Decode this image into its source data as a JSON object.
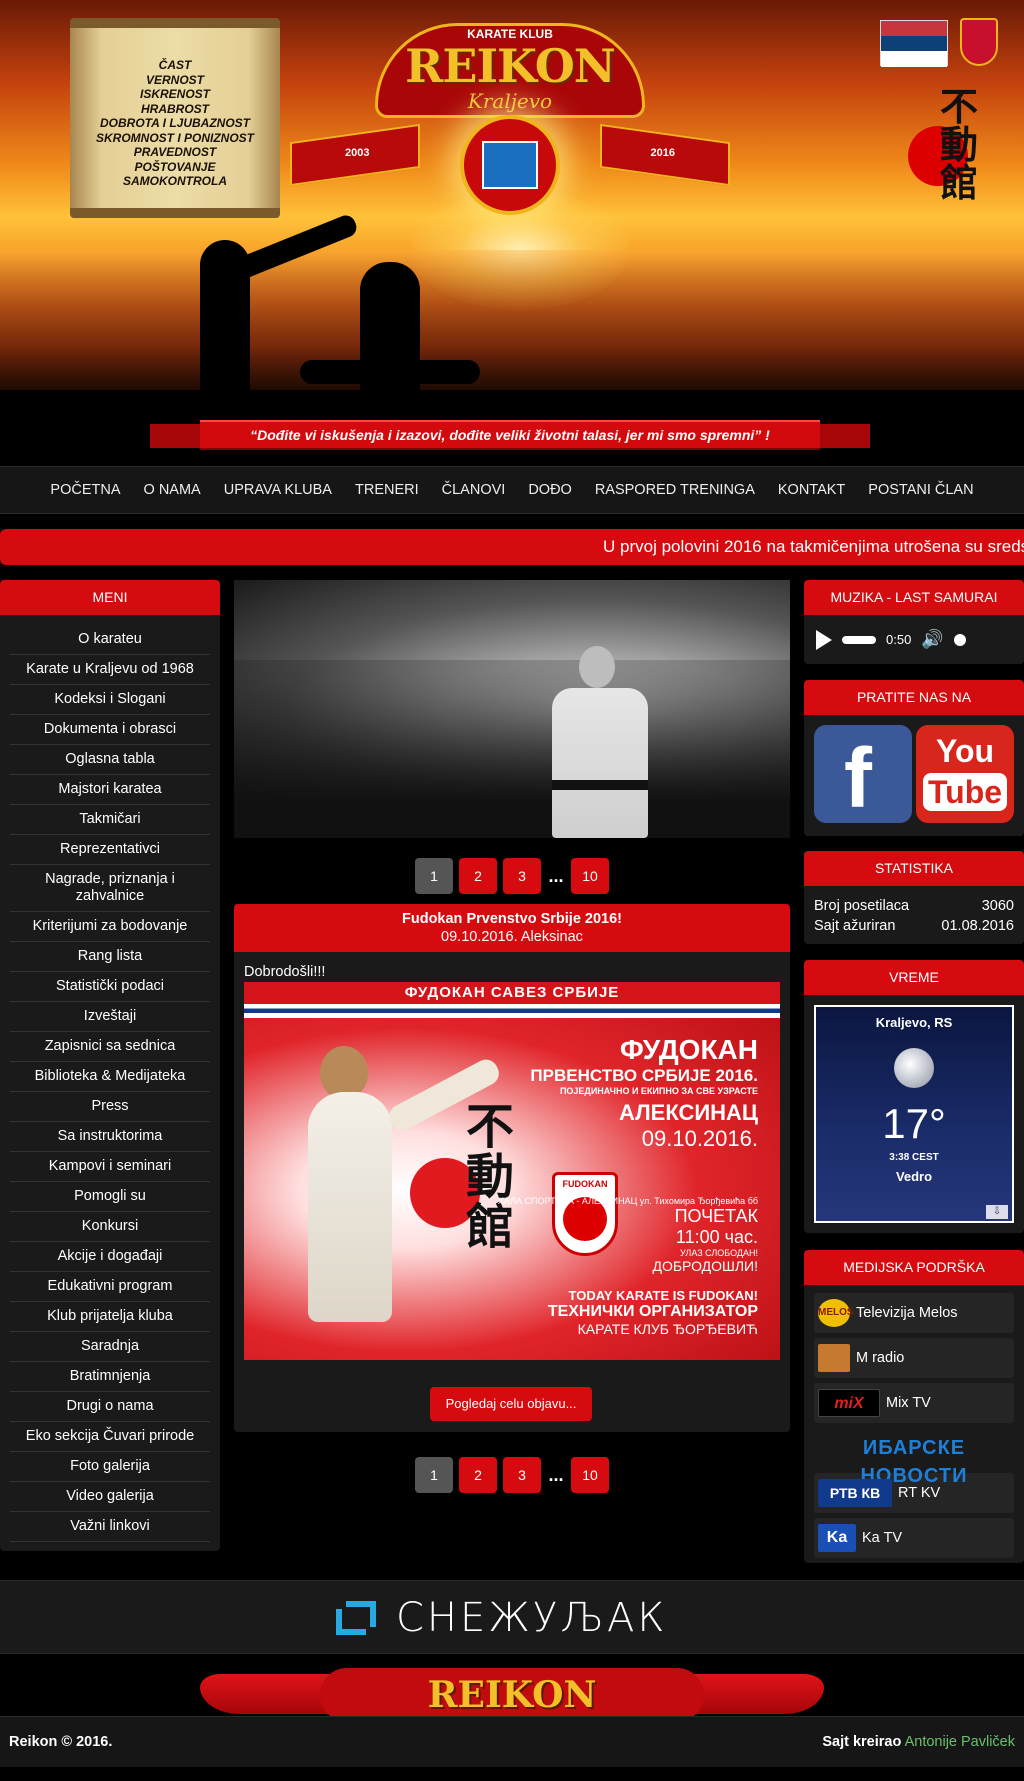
{
  "header": {
    "virtues": [
      "ČAST",
      "VERNOST",
      "ISKRENOST",
      "HRABROST",
      "DOBROTA I LJUBAZNOST",
      "SKROMNOST I PONIZNOST",
      "PRAVEDNOST",
      "POŠTOVANJE",
      "SAMOKONTROLA"
    ],
    "logo": {
      "club_label": "KARATE KLUB",
      "brand": "REIKON",
      "city": "Kraljevo",
      "year_left": "2003",
      "year_right": "2016"
    },
    "kanji": "不動館",
    "slogan": "“Dođite vi iskušenja i izazovi, dođite veliki životni talasi, jer mi smo spremni” !"
  },
  "nav": [
    "POČETNA",
    "O NAMA",
    "UPRAVA KLUBA",
    "TRENERI",
    "ČLANOVI",
    "DOĐO",
    "RASPORED TRENINGA",
    "KONTAKT",
    "POSTANI ČLAN"
  ],
  "ticker": "U prvoj polovini 2016 na takmičenjima utrošena su sreds",
  "left_menu": {
    "title": "MENI",
    "items": [
      "O karateu",
      "Karate u Kraljevu od 1968",
      "Kodeksi i Slogani",
      "Dokumenta i obrasci",
      "Oglasna tabla",
      "Majstori karatea",
      "Takmičari",
      "Reprezentativci",
      "Nagrade, priznanja i zahvalnice",
      "Kriterijumi za bodovanje",
      "Rang lista",
      "Statistički podaci",
      "Izveštaji",
      "Zapisnici sa sednica",
      "Biblioteka & Medijateka",
      "Press",
      "Sa instruktorima",
      "Kampovi i seminari",
      "Pomogli su",
      "Konkursi",
      "Akcije i događaji",
      "Edukativni program",
      "Klub prijatelja kluba",
      "Saradnja",
      "Bratimnjenja",
      "Drugi o nama",
      "Eko sekcija Čuvari prirode",
      "Foto galerija",
      "Video galerija",
      "Važni linkovi"
    ]
  },
  "pagination": {
    "pages": [
      "1",
      "2",
      "3",
      "10"
    ],
    "ellipsis": "...",
    "active": "1"
  },
  "post": {
    "title": "Fudokan Prvenstvo Srbije 2016!",
    "subtitle": "09.10.2016. Aleksinac",
    "greeting": "Dobrodošli!!!",
    "more_button": "Pogledaj celu objavu...",
    "poster": {
      "header": "ФУДОКАН САВЕЗ СРБИЈЕ",
      "line1": "ФУДОКАН",
      "line2": "ПРВЕНСТВО СРБИЈЕ 2016.",
      "line3": "ПОЈЕДИНАЧНО И ЕКИПНО ЗА СВЕ УЗРАСТЕ",
      "line4": "АЛЕКСИНАЦ",
      "line5": "09.10.2016.",
      "line6": "ХАЛА СПОРТОВА - АЛЕКСИНАЦ ул. Тихомира Ђорђевића бб",
      "line7": "ПОЧЕТАК",
      "line8": "11:00 час.",
      "line9": "УЛАЗ СЛОБОДАН!",
      "line10": "ДОБРОДОШЛИ!",
      "bottom1": "TODAY KARATE IS FUDOKAN!",
      "bottom2": "ТЕХНИЧКИ ОРГАНИЗАТОР",
      "bottom3": "КАРАТЕ КЛУБ ЂОРЂЕВИЋ",
      "shield_label": "FUDOKAN",
      "kanji": "不動館"
    }
  },
  "music": {
    "title": "MUZIKA - LAST SAMURAI",
    "time": "0:50"
  },
  "social": {
    "title": "PRATITE NAS NA",
    "facebook_glyph": "f",
    "youtube_you": "You",
    "youtube_tube": "Tube"
  },
  "stats": {
    "title": "STATISTIKA",
    "rows": [
      {
        "label": "Broj posetilaca",
        "value": "3060"
      },
      {
        "label": "Sajt ažuriran",
        "value": "01.08.2016"
      }
    ]
  },
  "weather": {
    "title": "VREME",
    "city": "Kraljevo, RS",
    "temp": "17°",
    "time": "3:38 CEST",
    "condition": "Vedro"
  },
  "media": {
    "title": "MEDIJSKA PODRŠKA",
    "items": [
      {
        "logo": "MELOS",
        "name": "Televizija Melos"
      },
      {
        "logo": "",
        "name": "M radio"
      },
      {
        "logo": "miX",
        "name": "Mix TV"
      },
      {
        "logo": "ИБАРСКЕ НОВОСТИ",
        "name": ""
      },
      {
        "logo": "РТВ КВ",
        "name": "RT KV"
      },
      {
        "logo": "Ka",
        "name": "Ka TV"
      }
    ]
  },
  "sponsor": {
    "name": "СНЕЖУЉАК"
  },
  "footer": {
    "brand": "REIKON",
    "copyright": "Reikon © 2016.",
    "credit_label": "Sajt kreirao",
    "credit_author": "Antonije Pavliček"
  }
}
